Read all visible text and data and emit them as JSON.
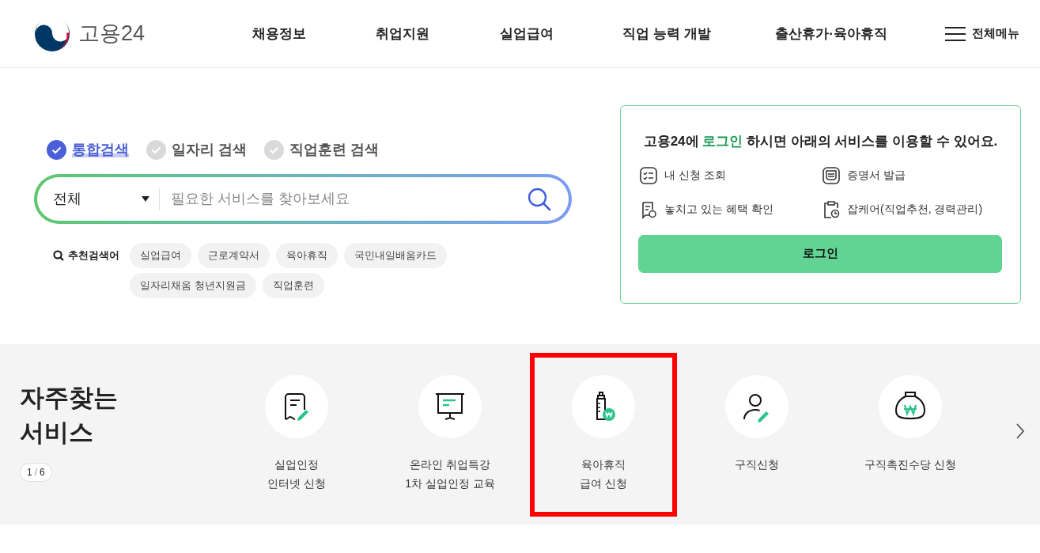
{
  "header": {
    "logo_text": "고용24",
    "nav": [
      "채용정보",
      "취업지원",
      "실업급여",
      "직업 능력 개발",
      "출산휴가·육아휴직"
    ],
    "all_menu": "전체메뉴"
  },
  "search": {
    "scopes": [
      {
        "label": "통합검색",
        "selected": true
      },
      {
        "label": "일자리 검색",
        "selected": false
      },
      {
        "label": "직업훈련 검색",
        "selected": false
      }
    ],
    "category": "전체",
    "placeholder": "필요한 서비스를 찾아보세요",
    "recommended_label": "추천검색어",
    "keywords": [
      "실업급여",
      "근로계약서",
      "육아휴직",
      "국민내일배움카드",
      "일자리채움 청년지원금",
      "직업훈련"
    ]
  },
  "login_card": {
    "message": "고용24에 **로그인** 하시면 아래의 서비스를 이용할 수 있어요.",
    "services": [
      {
        "kind": "checklist",
        "label": "내 신청 조회"
      },
      {
        "kind": "certificate",
        "label": "증명서 발급"
      },
      {
        "kind": "benefit",
        "label": "놓치고 있는 혜택 확인"
      },
      {
        "kind": "clipboard",
        "label": "잡케어(직업추천, 경력관리)"
      }
    ],
    "button": "로그인"
  },
  "frequent": {
    "title_lines": [
      "자주찾는",
      "서비스"
    ],
    "page": "1",
    "separator": "/",
    "total": "6",
    "services": [
      {
        "kind": "receipt",
        "lines": [
          "실업인정",
          "인터넷 신청"
        ],
        "highlighted": false
      },
      {
        "kind": "presentation",
        "lines": [
          "온라인 취업특강",
          "1차 실업인정 교육"
        ],
        "highlighted": false
      },
      {
        "kind": "bottle",
        "lines": [
          "육아휴직",
          "급여 신청"
        ],
        "highlighted": true
      },
      {
        "kind": "person",
        "lines": [
          "구직신청"
        ],
        "highlighted": false
      },
      {
        "kind": "moneybag",
        "lines": [
          "구직촉진수당 신청"
        ],
        "highlighted": false
      }
    ]
  }
}
